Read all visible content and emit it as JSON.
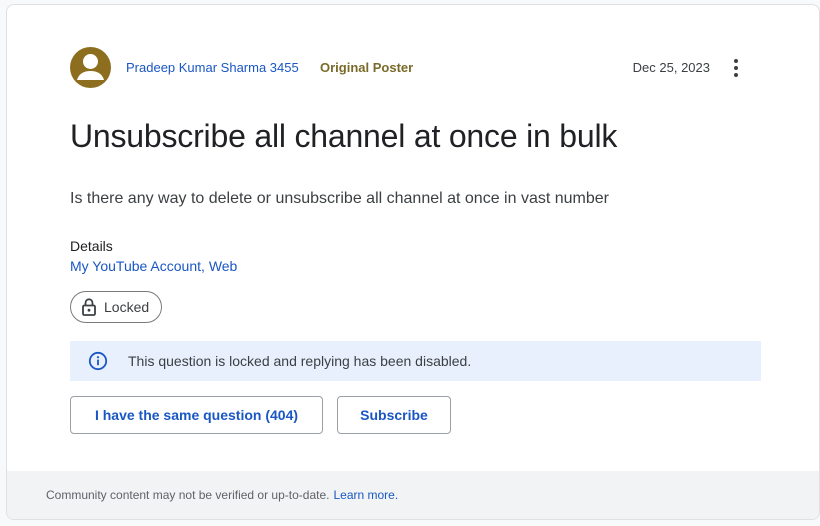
{
  "post": {
    "author": "Pradeep Kumar Sharma 3455",
    "badge": "Original Poster",
    "date": "Dec 25, 2023",
    "title": "Unsubscribe all channel at once in bulk",
    "body": "Is there any way to delete or unsubscribe all channel at once in vast number"
  },
  "details": {
    "label": "Details",
    "link_1": "My YouTube Account",
    "separator": ", ",
    "link_2": "Web"
  },
  "status": {
    "chip_label": "Locked",
    "notice": "This question is locked and replying has been disabled."
  },
  "actions": {
    "same_question": "I have the same question (404)",
    "subscribe": "Subscribe"
  },
  "footer": {
    "text": "Community content may not be verified or up-to-date.",
    "link": "Learn more."
  },
  "icons": {
    "avatar": "person-icon",
    "more": "more-vert-icon",
    "lock": "lock-icon",
    "info": "info-icon"
  },
  "colors": {
    "avatar_bg": "#8d6e1f",
    "link": "#1a57c4",
    "badge": "#7a6a2a",
    "notice_bg": "#e8f0fe",
    "footer_bg": "#f1f3f4"
  }
}
